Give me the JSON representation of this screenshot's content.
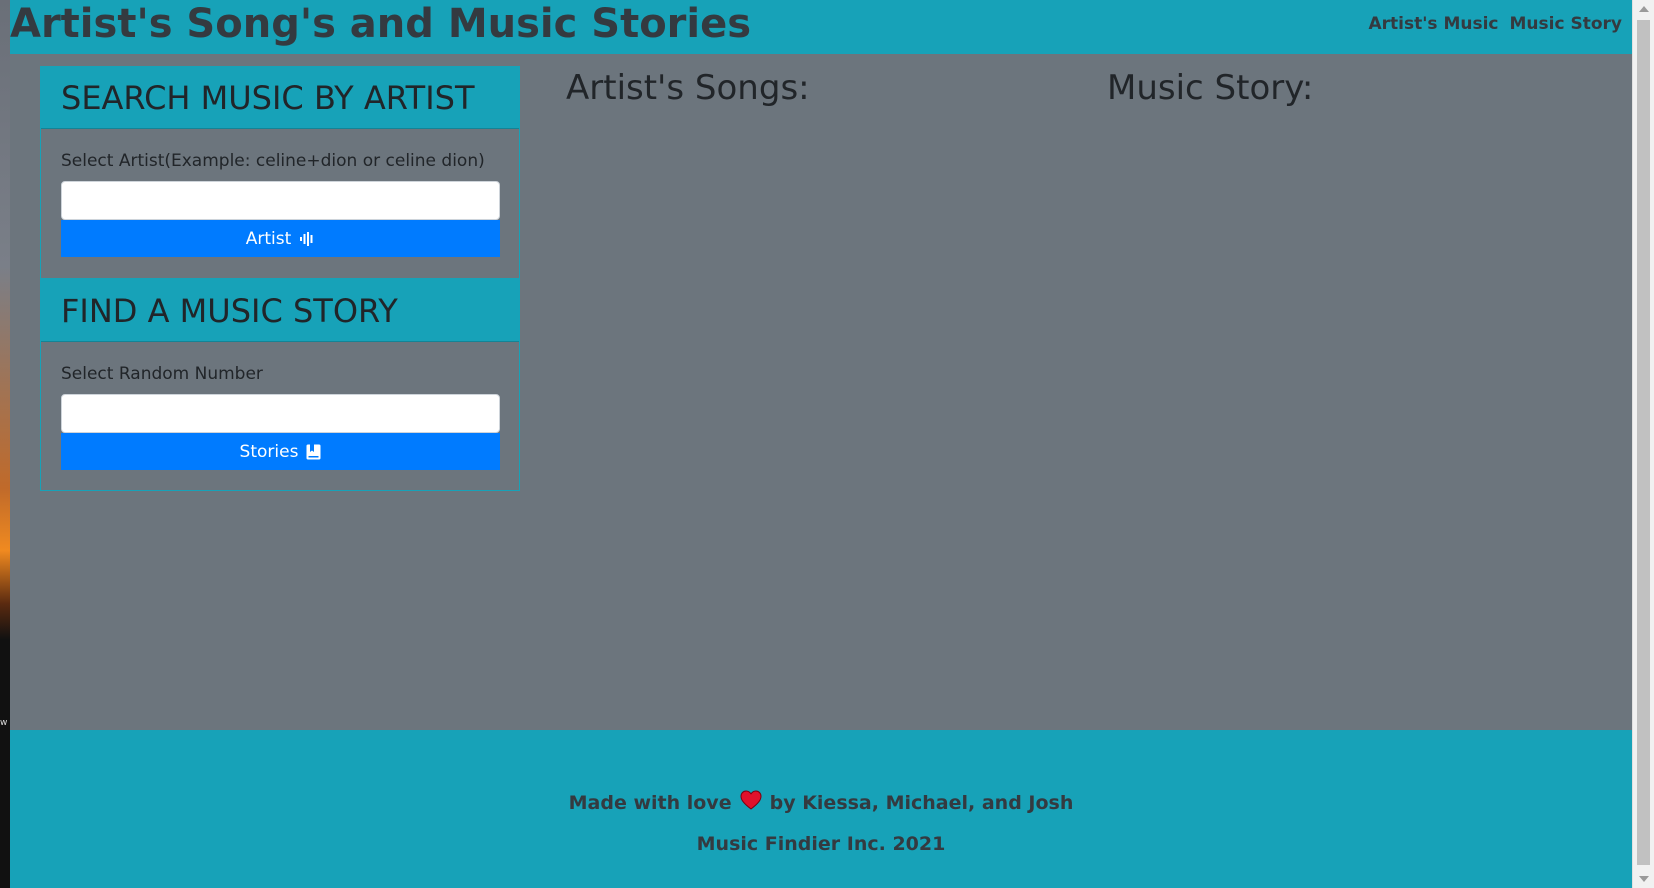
{
  "header": {
    "title": "Artist's Song's and Music Stories",
    "nav": [
      {
        "label": "Artist's Music"
      },
      {
        "label": "Music Story"
      }
    ]
  },
  "search_card": {
    "title": "SEARCH MUSIC BY ARTIST",
    "label": "Select Artist(Example: celine+dion or celine dion)",
    "input_value": "",
    "button_label": "Artist",
    "button_icon": "soundwave-icon"
  },
  "story_card": {
    "title": "FIND A MUSIC STORY",
    "label": "Select Random Number",
    "input_value": "",
    "button_label": "Stories",
    "button_icon": "journal-bookmark-icon"
  },
  "main": {
    "songs_heading": "Artist's Songs:",
    "story_heading": "Music Story:"
  },
  "footer": {
    "made_with": "Made with love",
    "heart_icon": "heart-icon",
    "authors": "by Kiessa, Michael, and Josh",
    "copyright": "Music Findier Inc. 2021"
  },
  "colors": {
    "header_bg": "#17a2b8",
    "page_bg": "#6c757d",
    "button_bg": "#007bff",
    "heart": "#e0112b"
  }
}
